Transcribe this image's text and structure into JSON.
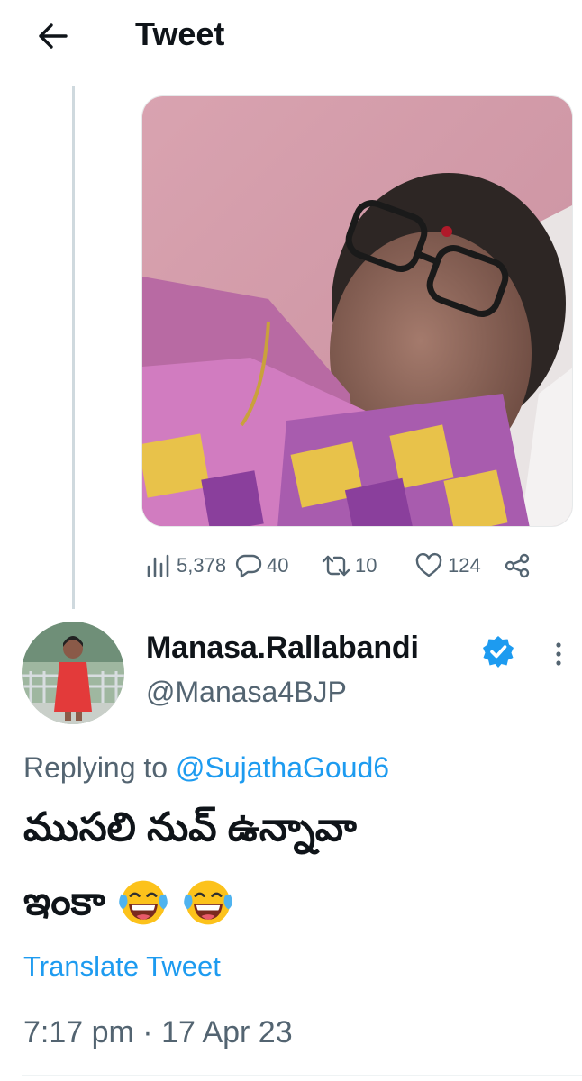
{
  "header": {
    "title": "Tweet",
    "back_icon": "arrow-left-icon"
  },
  "quoted_post": {
    "image_icon": "photo-of-woman-in-saree",
    "stats": {
      "views": "5,378",
      "replies": "40",
      "retweets": "10",
      "likes": "124"
    }
  },
  "tweet": {
    "author_name": "Manasa.Rallabandi",
    "author_handle": "@Manasa4BJP",
    "verified_icon": "verified-badge-icon",
    "replying_prefix": "Replying to",
    "replying_handle": "@SujathaGoud6",
    "text_line1": "ముసలి నువ్ ఉన్నావా",
    "text_line2": "ఇంకా",
    "emoji": "face-with-tears-of-joy-icon",
    "translate_label": "Translate Tweet",
    "timestamp": "7:17 pm · 17 Apr 23"
  },
  "colors": {
    "accent": "#1d9bf0",
    "secondary_text": "#536471",
    "primary_text": "#0f1419",
    "divider": "#eff3f4"
  }
}
